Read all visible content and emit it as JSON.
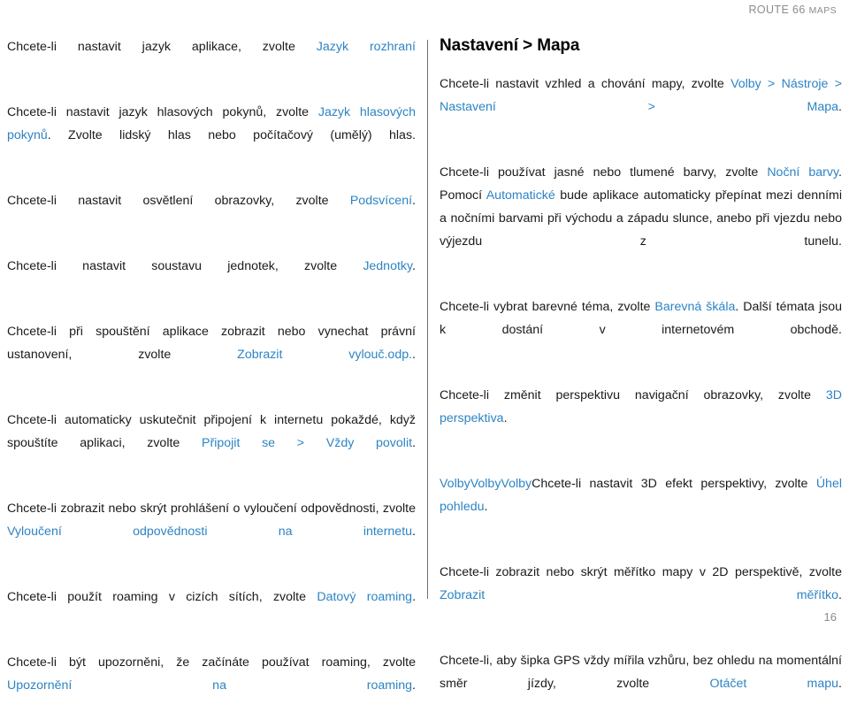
{
  "header": {
    "brand_primary": "ROUTE 66 ",
    "brand_secondary": "MAPS"
  },
  "colors": {
    "link": "#2d84c4",
    "body_text": "#1a1a1a",
    "header_gray": "#8c8c8c",
    "divider": "#6f6f6f",
    "background": "#ffffff"
  },
  "left_column": {
    "paragraphs": [
      {
        "id": "interface-language",
        "runs": [
          {
            "text": "Chcete-li nastavit jazyk aplikace, zvolte ",
            "style": "plain"
          },
          {
            "text": "Jazyk rozhraní",
            "style": "link"
          }
        ]
      },
      {
        "id": "voice-language",
        "runs": [
          {
            "text": "Chcete-li nastavit jazyk hlasových pokynů, zvolte ",
            "style": "plain"
          },
          {
            "text": "Jazyk hlasových pokynů",
            "style": "link"
          },
          {
            "text": ". Zvolte lidský hlas nebo počítačový (umělý) hlas.",
            "style": "plain"
          }
        ]
      },
      {
        "id": "backlight",
        "runs": [
          {
            "text": "Chcete-li nastavit osvětlení obrazovky, zvolte ",
            "style": "plain"
          },
          {
            "text": "Podsvícení",
            "style": "link"
          },
          {
            "text": ".",
            "style": "plain"
          }
        ]
      },
      {
        "id": "units",
        "runs": [
          {
            "text": "Chcete-li nastavit soustavu jednotek, zvolte ",
            "style": "plain"
          },
          {
            "text": "Jednotky",
            "style": "link"
          },
          {
            "text": ".",
            "style": "plain"
          }
        ]
      },
      {
        "id": "legal-disclaimer",
        "runs": [
          {
            "text": "Chcete-li při spouštění aplikace zobrazit nebo vynechat právní ustanovení, zvolte ",
            "style": "plain"
          },
          {
            "text": "Zobrazit vylouč.odp.",
            "style": "link"
          },
          {
            "text": ".",
            "style": "plain"
          }
        ]
      },
      {
        "id": "auto-connect",
        "runs": [
          {
            "text": "Chcete-li automaticky uskutečnit připojení k internetu pokaždé, když spouštíte aplikaci, zvolte ",
            "style": "plain"
          },
          {
            "text": "Připojit se > Vždy povolit",
            "style": "link"
          },
          {
            "text": ".",
            "style": "plain"
          }
        ]
      },
      {
        "id": "online-disclaimer",
        "runs": [
          {
            "text": "Chcete-li zobrazit nebo skrýt prohlášení o vyloučení odpovědnosti, zvolte ",
            "style": "plain"
          },
          {
            "text": "Vyloučení odpovědnosti na internetu",
            "style": "link"
          },
          {
            "text": ".",
            "style": "plain"
          }
        ]
      },
      {
        "id": "data-roaming",
        "runs": [
          {
            "text": "Chcete-li použít roaming v cizích sítích, zvolte ",
            "style": "plain"
          },
          {
            "text": "Datový roaming",
            "style": "link"
          },
          {
            "text": ".",
            "style": "plain"
          }
        ]
      },
      {
        "id": "roaming-warning",
        "runs": [
          {
            "text": "Chcete-li být upozorněni, že začínáte používat roaming, zvolte ",
            "style": "plain"
          },
          {
            "text": "Upozornění na roaming",
            "style": "link"
          },
          {
            "text": ".",
            "style": "plain"
          }
        ]
      }
    ]
  },
  "right_column": {
    "heading": "Nastavení > Mapa",
    "paragraphs": [
      {
        "id": "map-appearance",
        "runs": [
          {
            "text": "Chcete-li nastavit vzhled a chování mapy, zvolte ",
            "style": "plain"
          },
          {
            "text": "Volby > Nástroje > Nastavení > Mapa",
            "style": "link"
          },
          {
            "text": ".",
            "style": "plain"
          }
        ]
      },
      {
        "id": "night-colors",
        "runs": [
          {
            "text": "Chcete-li používat jasné nebo tlumené barvy, zvolte ",
            "style": "plain"
          },
          {
            "text": "Noční barvy",
            "style": "link"
          },
          {
            "text": ". Pomocí ",
            "style": "plain"
          },
          {
            "text": "Automatické",
            "style": "link"
          },
          {
            "text": " bude aplikace automaticky přepínat mezi denními a nočními barvami při východu a západu slunce, anebo při vjezdu nebo výjezdu z tunelu.",
            "style": "plain"
          }
        ]
      },
      {
        "id": "color-scheme",
        "runs": [
          {
            "text": "Chcete-li vybrat barevné téma, zvolte ",
            "style": "plain"
          },
          {
            "text": "Barevná škála",
            "style": "link"
          },
          {
            "text": ". Další témata jsou k dostání v internetovém obchodě.",
            "style": "plain"
          }
        ]
      },
      {
        "id": "3d-perspective",
        "runs": [
          {
            "text": "Chcete-li změnit perspektivu navigační obrazovky, zvolte ",
            "style": "plain"
          },
          {
            "text": "3D perspektiva",
            "style": "link"
          },
          {
            "text": ".",
            "style": "plain"
          }
        ]
      },
      {
        "id": "view-angle",
        "runs": [
          {
            "text": "VolbyVolbyVolby",
            "style": "link"
          },
          {
            "text": "Chcete-li nastavit 3D efekt perspektivy, zvolte ",
            "style": "plain"
          },
          {
            "text": "Úhel pohledu",
            "style": "link"
          },
          {
            "text": ".",
            "style": "plain"
          }
        ]
      },
      {
        "id": "show-scale",
        "runs": [
          {
            "text": "Chcete-li zobrazit nebo skrýt měřítko mapy v 2D perspektivě, zvolte ",
            "style": "plain"
          },
          {
            "text": "Zobrazit měřítko",
            "style": "link"
          },
          {
            "text": ".",
            "style": "plain"
          }
        ]
      },
      {
        "id": "rotate-map",
        "runs": [
          {
            "text": "Chcete-li, aby šipka GPS vždy mířila vzhůru, bez ohledu na momentální směr jízdy, zvolte ",
            "style": "plain"
          },
          {
            "text": "Otáčet mapu",
            "style": "link"
          },
          {
            "text": ".",
            "style": "plain"
          }
        ]
      }
    ]
  },
  "footer": {
    "page_number": "16"
  }
}
